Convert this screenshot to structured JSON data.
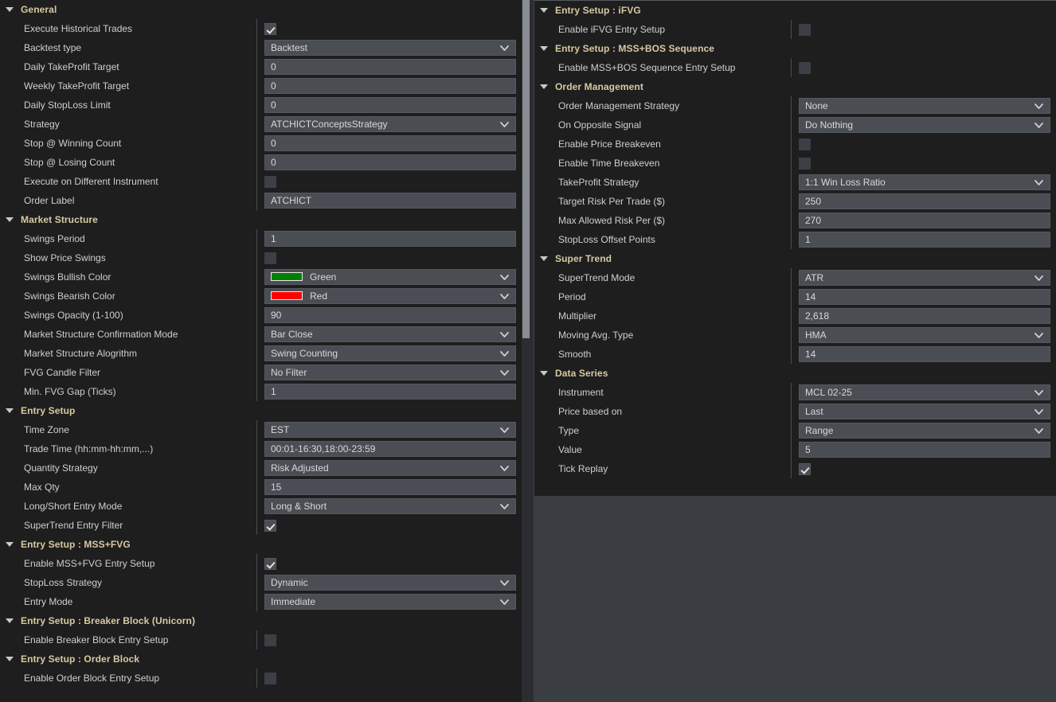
{
  "colors": {
    "panel_bg": "#1e1e1e",
    "window_bg": "#3a3d42",
    "group_header_text": "#d9c9a3",
    "field_bg": "#4a4d54",
    "swing_bullish": "#008000",
    "swing_bearish": "#ff0000",
    "scrollbar_thumb": "#898d93"
  },
  "icons": {
    "collapse_triangle": "triangle-down-icon",
    "dropdown_chevron": "chevron-down-icon",
    "checkbox_check": "checkmark-icon"
  },
  "left_panel": {
    "groups": [
      {
        "title": "General",
        "rows": [
          {
            "label": "Execute Historical Trades",
            "type": "checkbox",
            "checked": true
          },
          {
            "label": "Backtest type",
            "type": "select",
            "value": "Backtest"
          },
          {
            "label": "Daily TakeProfit Target",
            "type": "text",
            "value": "0"
          },
          {
            "label": "Weekly TakeProfit Target",
            "type": "text",
            "value": "0"
          },
          {
            "label": "Daily StopLoss Limit",
            "type": "text",
            "value": "0"
          },
          {
            "label": "Strategy",
            "type": "select",
            "value": "ATCHICTConceptsStrategy"
          },
          {
            "label": "Stop @ Winning Count",
            "type": "text",
            "value": "0"
          },
          {
            "label": "Stop @ Losing Count",
            "type": "text",
            "value": "0"
          },
          {
            "label": "Execute on Different Instrument",
            "type": "checkbox",
            "checked": false
          },
          {
            "label": "Order Label",
            "type": "text",
            "value": "ATCHICT"
          }
        ]
      },
      {
        "title": "Market Structure",
        "rows": [
          {
            "label": "Swings Period",
            "type": "text",
            "value": "1"
          },
          {
            "label": "Show Price Swings",
            "type": "checkbox",
            "checked": false
          },
          {
            "label": "Swings Bullish Color",
            "type": "color",
            "value": "Green",
            "swatch": "#008000"
          },
          {
            "label": "Swings Bearish Color",
            "type": "color",
            "value": "Red",
            "swatch": "#ff0000"
          },
          {
            "label": "Swings Opacity (1-100)",
            "type": "text",
            "value": "90"
          },
          {
            "label": "Market Structure Confirmation Mode",
            "type": "select",
            "value": "Bar Close"
          },
          {
            "label": "Market Structure Alogrithm",
            "type": "select",
            "value": "Swing Counting"
          },
          {
            "label": "FVG Candle Filter",
            "type": "select",
            "value": "No Filter"
          },
          {
            "label": "Min. FVG Gap (Ticks)",
            "type": "text",
            "value": "1"
          }
        ]
      },
      {
        "title": "Entry Setup",
        "rows": [
          {
            "label": "Time Zone",
            "type": "select",
            "value": "EST"
          },
          {
            "label": "Trade Time (hh:mm-hh:mm,...)",
            "type": "text",
            "value": "00:01-16:30,18:00-23:59"
          },
          {
            "label": "Quantity Strategy",
            "type": "select",
            "value": "Risk Adjusted"
          },
          {
            "label": "Max Qty",
            "type": "text",
            "value": "15"
          },
          {
            "label": "Long/Short Entry Mode",
            "type": "select",
            "value": "Long & Short"
          },
          {
            "label": "SuperTrend Entry Filter",
            "type": "checkbox",
            "checked": true
          }
        ]
      },
      {
        "title": "Entry Setup : MSS+FVG",
        "rows": [
          {
            "label": "Enable MSS+FVG Entry Setup",
            "type": "checkbox",
            "checked": true
          },
          {
            "label": "StopLoss Strategy",
            "type": "select",
            "value": "Dynamic"
          },
          {
            "label": "Entry Mode",
            "type": "select",
            "value": "Immediate"
          }
        ]
      },
      {
        "title": "Entry Setup : Breaker Block (Unicorn)",
        "rows": [
          {
            "label": "Enable Breaker Block Entry Setup",
            "type": "checkbox",
            "checked": false
          }
        ]
      },
      {
        "title": "Entry Setup : Order Block",
        "rows": [
          {
            "label": "Enable Order Block Entry Setup",
            "type": "checkbox",
            "checked": false
          }
        ]
      }
    ]
  },
  "right_panel": {
    "groups": [
      {
        "title": "Entry Setup : iFVG",
        "rows": [
          {
            "label": "Enable iFVG Entry Setup",
            "type": "checkbox",
            "checked": false
          }
        ]
      },
      {
        "title": "Entry Setup : MSS+BOS Sequence",
        "rows": [
          {
            "label": "Enable MSS+BOS Sequence Entry Setup",
            "type": "checkbox",
            "checked": false
          }
        ]
      },
      {
        "title": "Order Management",
        "rows": [
          {
            "label": "Order Management Strategy",
            "type": "select",
            "value": "None"
          },
          {
            "label": "On Opposite Signal",
            "type": "select",
            "value": "Do Nothing"
          },
          {
            "label": "Enable Price Breakeven",
            "type": "checkbox",
            "checked": false
          },
          {
            "label": "Enable Time Breakeven",
            "type": "checkbox",
            "checked": false
          },
          {
            "label": "TakeProfit Strategy",
            "type": "select",
            "value": "1:1 Win Loss Ratio"
          },
          {
            "label": "Target Risk Per Trade ($)",
            "type": "text",
            "value": "250"
          },
          {
            "label": "Max Allowed Risk Per ($)",
            "type": "text",
            "value": "270"
          },
          {
            "label": "StopLoss Offset Points",
            "type": "text",
            "value": "1"
          }
        ]
      },
      {
        "title": "Super Trend",
        "rows": [
          {
            "label": "SuperTrend Mode",
            "type": "select",
            "value": "ATR"
          },
          {
            "label": "Period",
            "type": "text",
            "value": "14"
          },
          {
            "label": "Multiplier",
            "type": "text",
            "value": "2,618"
          },
          {
            "label": "Moving Avg. Type",
            "type": "select",
            "value": "HMA"
          },
          {
            "label": "Smooth",
            "type": "text",
            "value": "14"
          }
        ]
      },
      {
        "title": "Data Series",
        "rows": [
          {
            "label": "Instrument",
            "type": "select",
            "value": "MCL 02-25"
          },
          {
            "label": "Price based on",
            "type": "select",
            "value": "Last"
          },
          {
            "label": "Type",
            "type": "select",
            "value": "Range"
          },
          {
            "label": "Value",
            "type": "text",
            "value": "5"
          },
          {
            "label": "Tick Replay",
            "type": "checkbox",
            "checked": true
          }
        ]
      }
    ]
  },
  "scrollbar": {
    "name": "vertical-scrollbar",
    "thumb_top": 0,
    "thumb_height": 425
  }
}
